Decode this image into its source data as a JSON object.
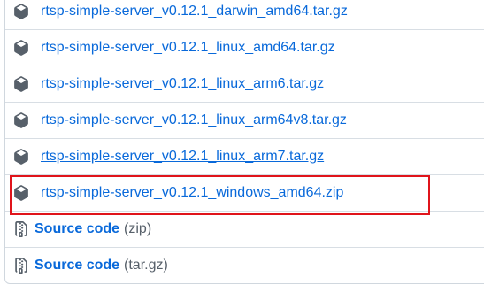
{
  "assets": [
    {
      "name": "rtsp-simple-server_v0.12.1_darwin_amd64.tar.gz",
      "icon": "package-icon"
    },
    {
      "name": "rtsp-simple-server_v0.12.1_linux_amd64.tar.gz",
      "icon": "package-icon"
    },
    {
      "name": "rtsp-simple-server_v0.12.1_linux_arm6.tar.gz",
      "icon": "package-icon"
    },
    {
      "name": "rtsp-simple-server_v0.12.1_linux_arm64v8.tar.gz",
      "icon": "package-icon"
    },
    {
      "name": "rtsp-simple-server_v0.12.1_linux_arm7.tar.gz",
      "icon": "package-icon"
    },
    {
      "name": "rtsp-simple-server_v0.12.1_windows_amd64.zip",
      "icon": "package-icon"
    }
  ],
  "source_code": [
    {
      "label": "Source code",
      "format": "(zip)",
      "icon": "file-zip-icon"
    },
    {
      "label": "Source code",
      "format": "(tar.gz)",
      "icon": "file-zip-icon"
    }
  ],
  "colors": {
    "link": "#0969da",
    "muted": "#57606a",
    "border": "#d0d7de",
    "highlight": "#e0141b"
  }
}
